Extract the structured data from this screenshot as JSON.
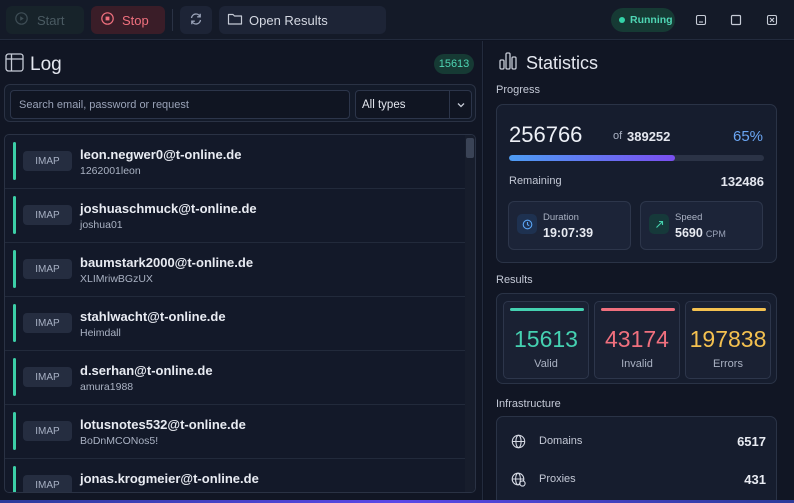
{
  "toolbar": {
    "start_label": "Start",
    "stop_label": "Stop",
    "open_results_label": "Open Results",
    "status": "Running"
  },
  "log": {
    "title": "Log",
    "count": "15613",
    "search_placeholder": "Search email, password or request",
    "type_filter": "All types",
    "entries": [
      {
        "protocol": "IMAP",
        "email": "leon.negwer0@t-online.de",
        "password": "1262001leon"
      },
      {
        "protocol": "IMAP",
        "email": "joshuaschmuck@t-online.de",
        "password": "joshua01"
      },
      {
        "protocol": "IMAP",
        "email": "baumstark2000@t-online.de",
        "password": "XLIMriwBGzUX"
      },
      {
        "protocol": "IMAP",
        "email": "stahlwacht@t-online.de",
        "password": "Heimdall"
      },
      {
        "protocol": "IMAP",
        "email": "d.serhan@t-online.de",
        "password": "amura1988"
      },
      {
        "protocol": "IMAP",
        "email": "lotusnotes532@t-online.de",
        "password": "BoDnMCONos5!"
      },
      {
        "protocol": "IMAP",
        "email": "jonas.krogmeier@t-online.de",
        "password": ""
      }
    ]
  },
  "stats": {
    "title": "Statistics",
    "progress": {
      "label": "Progress",
      "current": "256766",
      "of_label": "of",
      "total": "389252",
      "percent": "65%",
      "fill_fraction": 0.65,
      "remaining_label": "Remaining",
      "remaining": "132486",
      "duration_label": "Duration",
      "duration": "19:07:39",
      "speed_label": "Speed",
      "speed": "5690",
      "speed_unit": "CPM"
    },
    "results": {
      "label": "Results",
      "valid": "15613",
      "valid_label": "Valid",
      "invalid": "43174",
      "invalid_label": "Invalid",
      "errors": "197838",
      "errors_label": "Errors"
    },
    "infrastructure": {
      "label": "Infrastructure",
      "domains_label": "Domains",
      "domains": "6517",
      "proxies_label": "Proxies",
      "proxies": "431"
    }
  },
  "colors": {
    "valid": "#45d1b1",
    "invalid": "#f0707e",
    "errors": "#f4c150",
    "accent_blue": "#6aa5f2",
    "running": "#34d3a8"
  }
}
